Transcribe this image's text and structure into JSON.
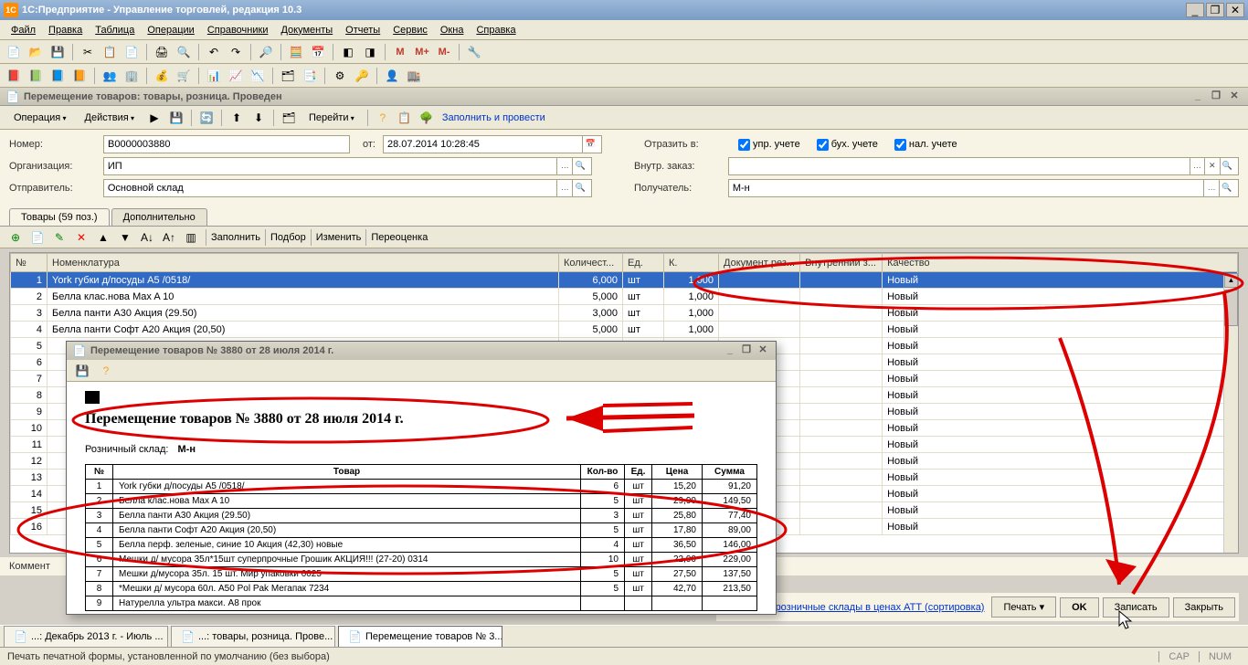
{
  "app": {
    "title": "1С:Предприятие - Управление торговлей, редакция 10.3"
  },
  "menubar": [
    "Файл",
    "Правка",
    "Таблица",
    "Операции",
    "Справочники",
    "Документы",
    "Отчеты",
    "Сервис",
    "Окна",
    "Справка"
  ],
  "mdi": {
    "title": "Перемещение товаров: товары, розница. Проведен"
  },
  "doc_toolbar": {
    "operation": "Операция",
    "actions": "Действия",
    "goto": "Перейти",
    "fill_post": "Заполнить и провести"
  },
  "form": {
    "number_label": "Номер:",
    "number": "B0000003880",
    "from_label": "от:",
    "from": "28.07.2014 10:28:45",
    "org_label": "Организация:",
    "org": "ИП",
    "sender_label": "Отправитель:",
    "sender": "Основной склад",
    "reflect_label": "Отразить в:",
    "chk_upr": "упр. учете",
    "chk_buh": "бух. учете",
    "chk_nal": "нал. учете",
    "internal_order_label": "Внутр. заказ:",
    "internal_order": "",
    "receiver_label": "Получатель:",
    "receiver": "М-н"
  },
  "tabs": {
    "goods": "Товары (59 поз.)",
    "extra": "Дополнительно"
  },
  "grid_toolbar": {
    "fill": "Заполнить",
    "select": "Подбор",
    "change": "Изменить",
    "revalue": "Переоценка"
  },
  "grid": {
    "cols": [
      "№",
      "Номенклатура",
      "Количест...",
      "Ед.",
      "К.",
      "Документ рез...",
      "Внутренний з...",
      "Качество"
    ],
    "rows": [
      {
        "n": 1,
        "name": "York губки д/посуды А5 /0518/",
        "qty": "6,000",
        "unit": "шт",
        "k": "1,000",
        "q": "Новый"
      },
      {
        "n": 2,
        "name": "Белла клас.нова Max A 10",
        "qty": "5,000",
        "unit": "шт",
        "k": "1,000",
        "q": "Новый"
      },
      {
        "n": 3,
        "name": "Белла панти A30 Акция (29.50)",
        "qty": "3,000",
        "unit": "шт",
        "k": "1,000",
        "q": "Новый"
      },
      {
        "n": 4,
        "name": "Белла панти Софт A20 Акция (20,50)",
        "qty": "5,000",
        "unit": "шт",
        "k": "1,000",
        "q": "Новый"
      },
      {
        "n": 5,
        "name": "",
        "qty": "",
        "unit": "",
        "k": "",
        "q": "Новый"
      },
      {
        "n": 6,
        "name": "",
        "qty": "",
        "unit": "",
        "k": "",
        "q": "Новый"
      },
      {
        "n": 7,
        "name": "",
        "qty": "",
        "unit": "",
        "k": "",
        "q": "Новый"
      },
      {
        "n": 8,
        "name": "",
        "qty": "",
        "unit": "",
        "k": "",
        "q": "Новый"
      },
      {
        "n": 9,
        "name": "",
        "qty": "",
        "unit": "",
        "k": "",
        "q": "Новый"
      },
      {
        "n": 10,
        "name": "",
        "qty": "",
        "unit": "",
        "k": "",
        "q": "Новый"
      },
      {
        "n": 11,
        "name": "",
        "qty": "",
        "unit": "",
        "k": "",
        "q": "Новый"
      },
      {
        "n": 12,
        "name": "",
        "qty": "",
        "unit": "",
        "k": "",
        "q": "Новый"
      },
      {
        "n": 13,
        "name": "",
        "qty": "",
        "unit": "",
        "k": "",
        "q": "Новый"
      },
      {
        "n": 14,
        "name": "",
        "qty": "",
        "unit": "",
        "k": "",
        "q": "Новый"
      },
      {
        "n": 15,
        "name": "",
        "qty": "",
        "unit": "",
        "k": "",
        "q": "Новый"
      },
      {
        "n": 16,
        "name": "",
        "qty": "",
        "unit": "",
        "k": "",
        "q": "Новый"
      }
    ]
  },
  "comment_label": "Коммент",
  "buttons": {
    "print_link": "Приход на розничные склады в ценах АТТ (сортировка)",
    "print": "Печать",
    "ok": "OK",
    "save": "Записать",
    "close": "Закрыть"
  },
  "popup": {
    "title": "Перемещение товаров № 3880 от 28 июля 2014 г.",
    "heading": "Перемещение товаров № 3880 от 28 июля 2014 г.",
    "warehouse_label": "Розничный склад:",
    "warehouse": "М-н",
    "cols": [
      "№",
      "Товар",
      "Кол-во",
      "Ед.",
      "Цена",
      "Сумма"
    ],
    "rows": [
      {
        "n": 1,
        "name": "York губки д/посуды А5 /0518/",
        "qty": "6",
        "unit": "шт",
        "price": "15,20",
        "sum": "91,20"
      },
      {
        "n": 2,
        "name": "Белла клас.нова Max A 10",
        "qty": "5",
        "unit": "шт",
        "price": "29,90",
        "sum": "149,50"
      },
      {
        "n": 3,
        "name": "Белла панти A30 Акция (29.50)",
        "qty": "3",
        "unit": "шт",
        "price": "25,80",
        "sum": "77,40"
      },
      {
        "n": 4,
        "name": "Белла панти Софт A20 Акция (20,50)",
        "qty": "5",
        "unit": "шт",
        "price": "17,80",
        "sum": "89,00"
      },
      {
        "n": 5,
        "name": "Белла перф. зеленые, синие 10 Акция (42,30) новые",
        "qty": "4",
        "unit": "шт",
        "price": "36,50",
        "sum": "146,00"
      },
      {
        "n": 6,
        "name": "Мешки д/ мусора 35л*15шт суперпрочные Грошик АКЦИЯ!!! (27-20) 0314",
        "qty": "10",
        "unit": "шт",
        "price": "22,90",
        "sum": "229,00"
      },
      {
        "n": 7,
        "name": "Мешки д/мусора 35л. 15 шт. Мир упаковки 6025",
        "qty": "5",
        "unit": "шт",
        "price": "27,50",
        "sum": "137,50"
      },
      {
        "n": 8,
        "name": "*Мешки д/ мусора 60л. A50 Pol Pak Мегапак 7234",
        "qty": "5",
        "unit": "шт",
        "price": "42,70",
        "sum": "213,50"
      },
      {
        "n": 9,
        "name": "Натурелла ультра макси. А8 прок",
        "qty": "",
        "unit": "",
        "price": "",
        "sum": ""
      }
    ]
  },
  "taskbar": {
    "t1": "...: Декабрь 2013 г. - Июль ...",
    "t2": "...: товары, розница. Прове...",
    "t3": "Перемещение товаров № 3..."
  },
  "status": {
    "msg": "Печать печатной формы, установленной по умолчанию (без выбора)",
    "cap": "CAP",
    "num": "NUM"
  }
}
